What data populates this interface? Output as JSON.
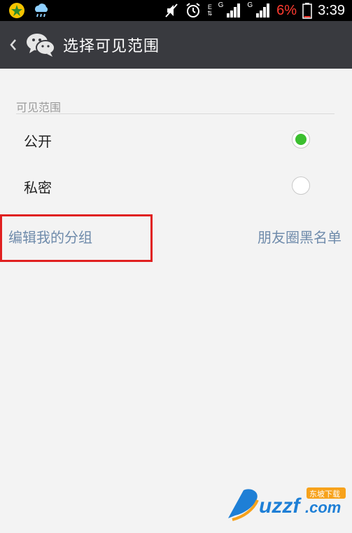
{
  "status_bar": {
    "battery_percent": "6%",
    "time": "3:39",
    "network_1": "G",
    "network_2": "G",
    "network_e": "E",
    "icons": [
      "app-icon",
      "weather-icon",
      "mute-icon",
      "alarm-icon",
      "data-arrows-icon",
      "signal-icon",
      "signal-icon",
      "battery-icon"
    ]
  },
  "action_bar": {
    "back_icon": "chevron-left-icon",
    "logo_icon": "wechat-icon",
    "title": "选择可见范围"
  },
  "visibility": {
    "header": "可见范围",
    "options": [
      {
        "label": "公开",
        "selected": true
      },
      {
        "label": "私密",
        "selected": false
      }
    ]
  },
  "links": {
    "edit_groups": "编辑我的分组",
    "blacklist": "朋友圈黑名单"
  },
  "colors": {
    "action_bar_bg": "#393a3f",
    "radio_selected": "#3bbf2f",
    "link": "#6f8bab",
    "highlight": "#e02020"
  },
  "watermark": {
    "brand": "uzzf.com",
    "tagline": "东坡下载"
  }
}
